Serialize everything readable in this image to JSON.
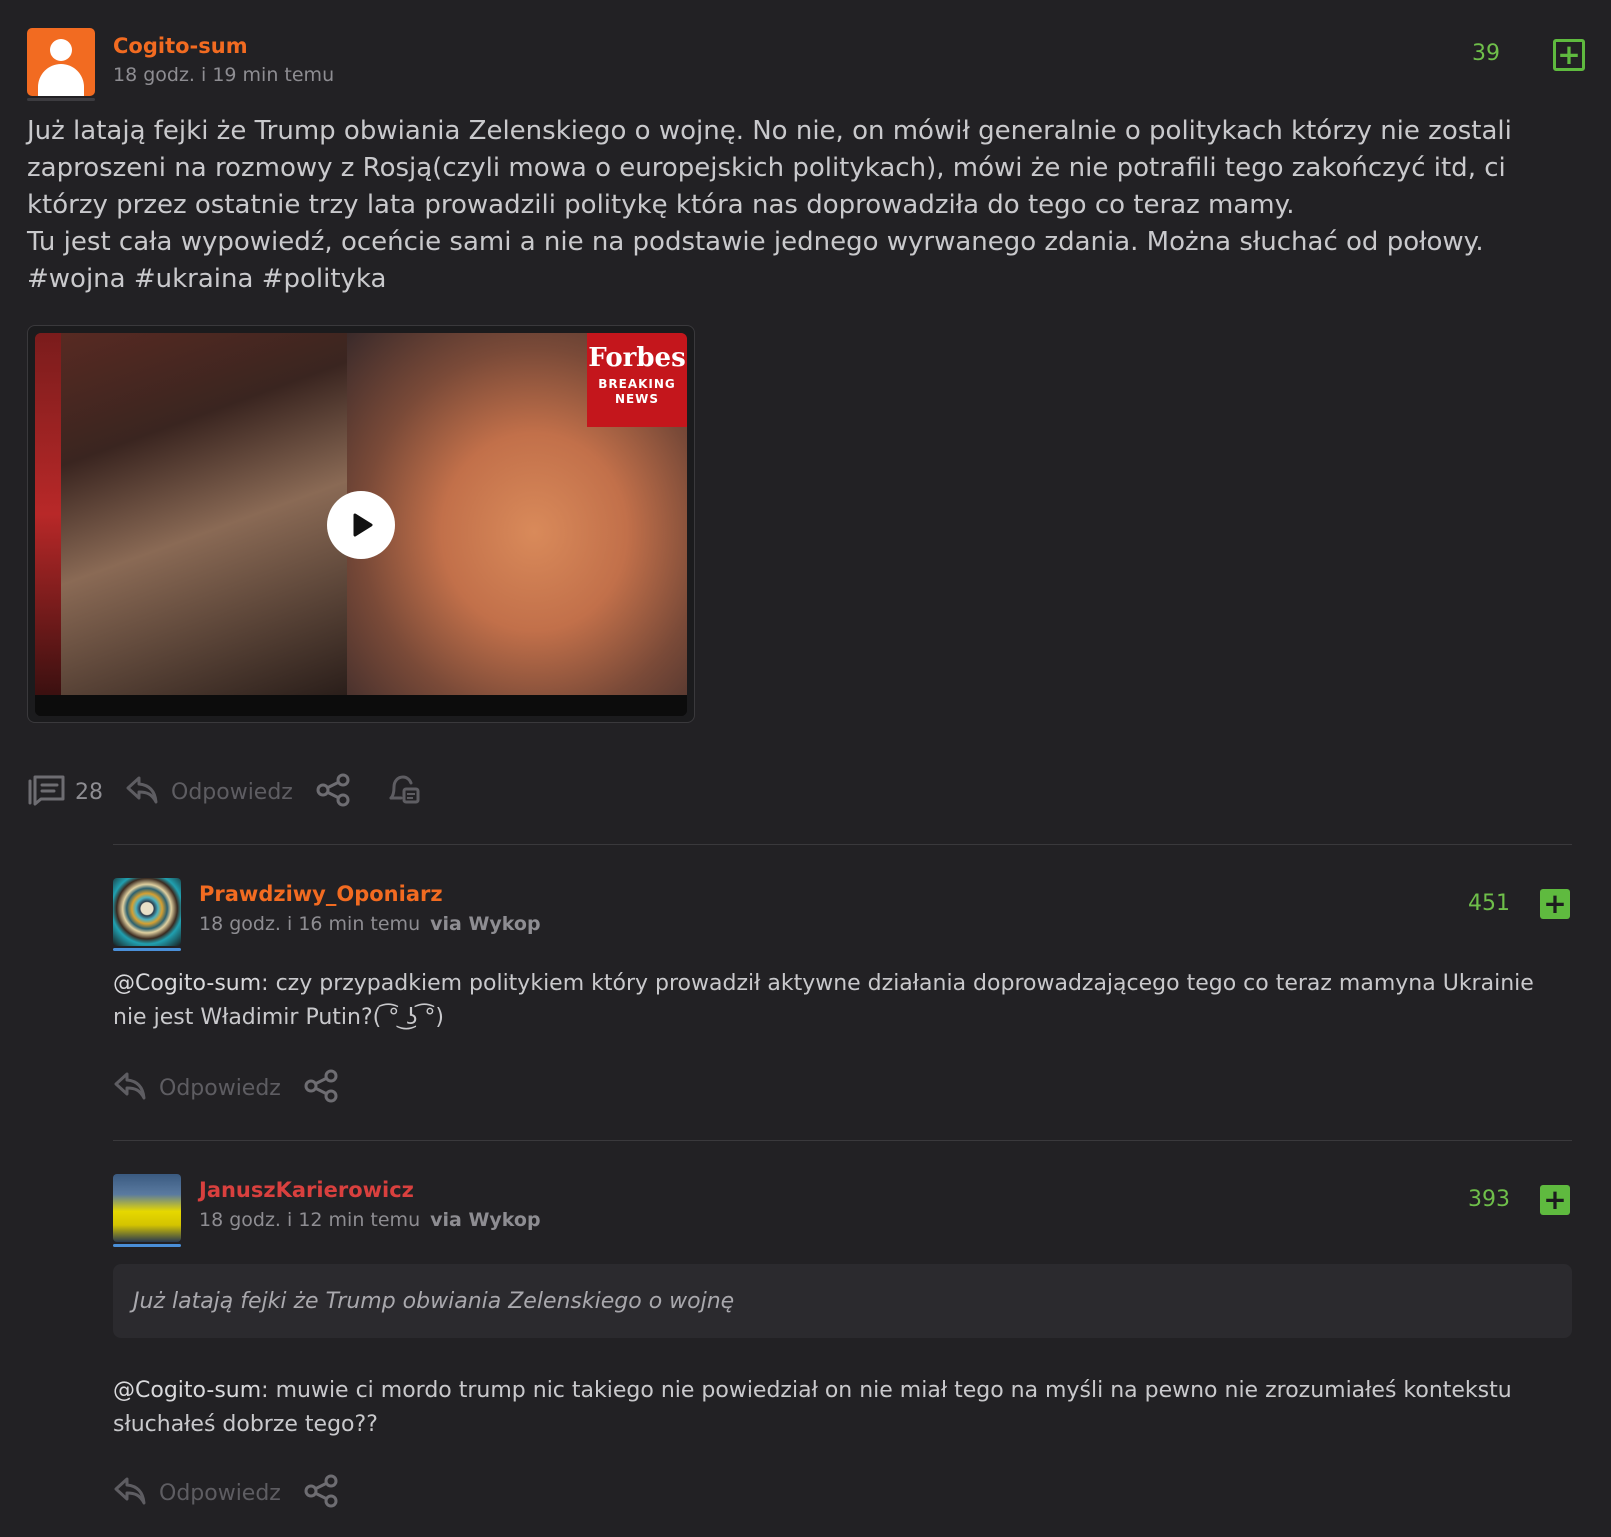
{
  "post": {
    "author": "Cogito-sum",
    "time": "18 godz. i 19 min temu",
    "votes": "39",
    "text_lines": [
      "Już latają fejki że Trump obwiania Zelenskiego o wojnę. No nie, on mówił generalnie o politykach którzy nie zostali zaproszeni na rozmowy z Rosją(czyli mowa o europejskich politykach), mówi że nie potrafili tego zakończyć itd, ci którzy przez ostatnie trzy lata prowadzili politykę która nas doprowadziła do tego co teraz mamy.",
      "Tu jest cała wypowiedź, oceńcie sami a nie na podstawie jednego wyrwanego zdania. Można słuchać od połowy.",
      "#wojna #ukraina #polityka"
    ],
    "video": {
      "brand": "Forbes",
      "badge_line1": "BREAKING",
      "badge_line2": "NEWS"
    },
    "comments_count": "28",
    "reply_label": "Odpowiedz",
    "icons": [
      "comments-icon",
      "reply-icon",
      "share-icon",
      "notify-icon"
    ]
  },
  "comments": [
    {
      "author": "Prawdziwy_Oponiarz",
      "time": "18 godz. i 16 min temu",
      "via": "via Wykop",
      "votes": "451",
      "mention": "@Cogito-sum",
      "text": ": czy przypadkiem politykiem który prowadził aktywne działania doprowadzającego tego co teraz mamyna Ukrainie nie jest Władimir Putin?( ͡° ͜ʖ ͡°)",
      "reply_label": "Odpowiedz"
    },
    {
      "author": "JanuszKarierowicz",
      "time": "18 godz. i 12 min temu",
      "via": "via Wykop",
      "votes": "393",
      "quote": "Już latają fejki że Trump obwiania Zelenskiego o wojnę",
      "mention": "@Cogito-sum",
      "text": ": muwie ci mordo trump nic takiego nie powiedział on nie miał tego na myśli na pewno nie zrozumiałeś kontekstu słuchałeś dobrze tego??",
      "reply_label": "Odpowiedz"
    }
  ],
  "colors": {
    "background": "#222124",
    "accent_orange": "#f26b21",
    "accent_red": "#d9403e",
    "vote_green": "#5fba3f"
  }
}
